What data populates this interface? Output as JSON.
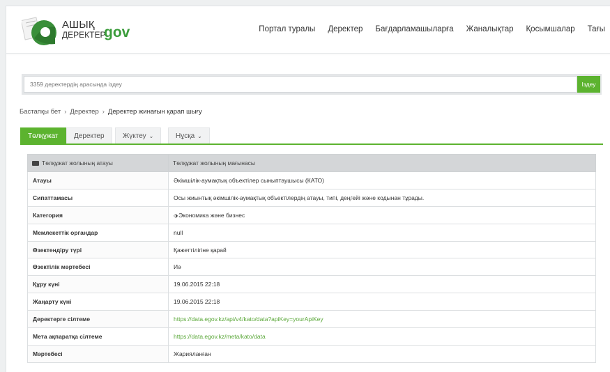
{
  "header": {
    "logo_line1": "АШЫҚ",
    "logo_line2": "ДЕРЕКТЕР",
    "logo_gov": "gov",
    "nav": [
      "Портал туралы",
      "Деректер",
      "Бағдарламашыларға",
      "Жаналықтар",
      "Қосымшалар",
      "Тағы"
    ]
  },
  "search": {
    "placeholder": "3359 деректердің арасында іздеу",
    "button": "Іздеу"
  },
  "breadcrumb": {
    "items": [
      "Бастапқы бет",
      "Деректер",
      "Деректер жинағын қарап шығу"
    ]
  },
  "tabs": {
    "items": [
      "Төлқұжат",
      "Деректер",
      "Жүктеу",
      "Нұсқа"
    ],
    "active": "Төлқұжат"
  },
  "table": {
    "header_name": "Төлқұжат жолының атауы",
    "header_value": "Төлқұжат жолының мағынасы",
    "rows": [
      {
        "label": "Атауы",
        "value": "Әкімшілік-аумақтық объектілер сыныптаушысы (КАТО)"
      },
      {
        "label": "Сипаттамасы",
        "value": "Осы жиынтық әкімшілік-аумақтық объектілердің атауы, типі, деңгейі және кодынан тұрады."
      },
      {
        "label": "Категория",
        "value": "Экономика және бизнес"
      },
      {
        "label": "Мемлекеттік органдар",
        "value": "null"
      },
      {
        "label": "Өзектендіру түрі",
        "value": "Қажеттілігіне қарай"
      },
      {
        "label": "Өзектілік мәртебесі",
        "value": "Иә"
      },
      {
        "label": "Құру күні",
        "value": "19.06.2015 22:18"
      },
      {
        "label": "Жаңарту күні",
        "value": "19.06.2015 22:18"
      },
      {
        "label": "Деректерге сілтеме",
        "value": "https://data.egov.kz/api/v4/kato/data?apiKey=yourApiKey"
      },
      {
        "label": "Мета ақпаратқа сілтеме",
        "value": "https://data.egov.kz/meta/kato/data"
      },
      {
        "label": "Мәртебесі",
        "value": "Жарияланған"
      }
    ]
  },
  "colors": {
    "accent": "#5cb32f",
    "header_row": "#d4d6d8"
  }
}
